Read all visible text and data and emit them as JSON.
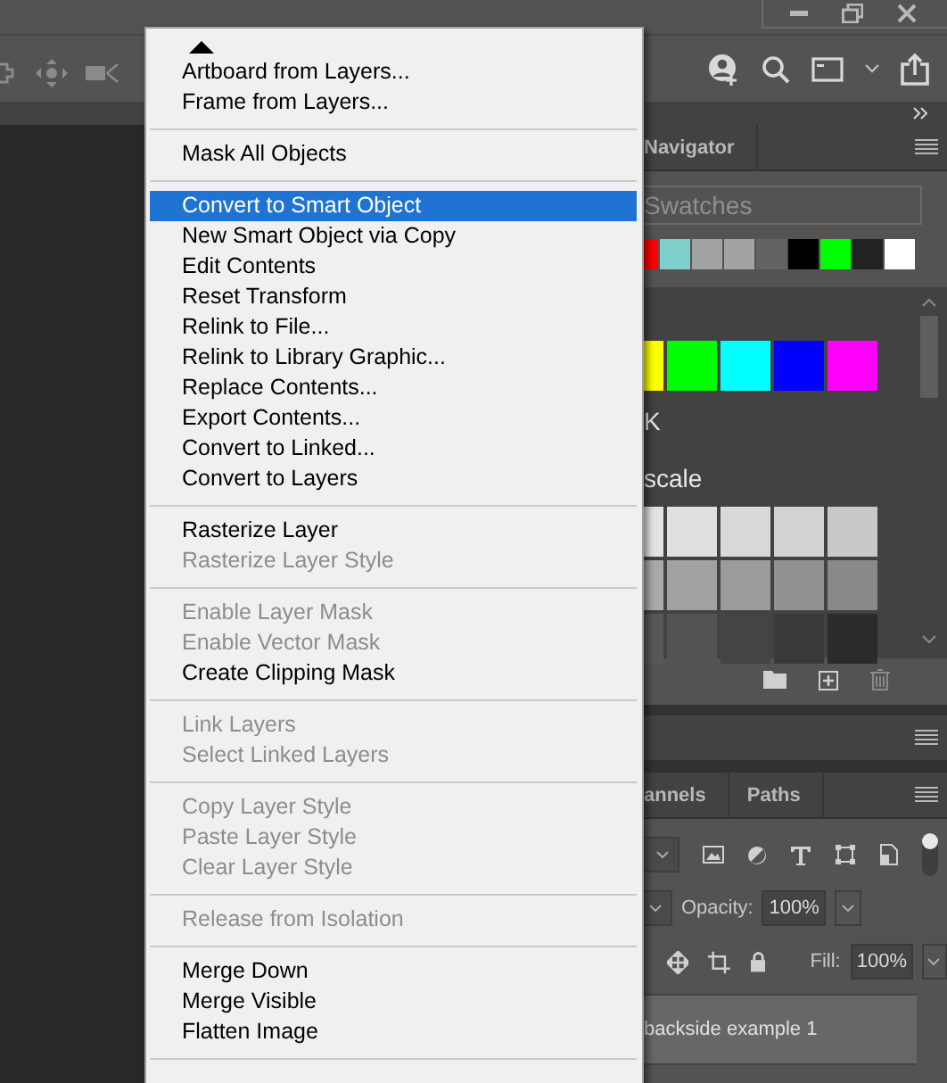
{
  "menu": {
    "sections": [
      {
        "items": [
          {
            "label": "Artboard from Layers...",
            "disabled": false,
            "selected": false
          },
          {
            "label": "Frame from Layers...",
            "disabled": false,
            "selected": false
          }
        ]
      },
      {
        "items": [
          {
            "label": "Mask All Objects",
            "disabled": false,
            "selected": false
          }
        ]
      },
      {
        "items": [
          {
            "label": "Convert to Smart Object",
            "disabled": false,
            "selected": true
          },
          {
            "label": "New Smart Object via Copy",
            "disabled": false,
            "selected": false
          },
          {
            "label": "Edit Contents",
            "disabled": false,
            "selected": false
          },
          {
            "label": "Reset Transform",
            "disabled": false,
            "selected": false
          },
          {
            "label": "Relink to File...",
            "disabled": false,
            "selected": false
          },
          {
            "label": "Relink to Library Graphic...",
            "disabled": false,
            "selected": false
          },
          {
            "label": "Replace Contents...",
            "disabled": false,
            "selected": false
          },
          {
            "label": "Export Contents...",
            "disabled": false,
            "selected": false
          },
          {
            "label": "Convert to Linked...",
            "disabled": false,
            "selected": false
          },
          {
            "label": "Convert to Layers",
            "disabled": false,
            "selected": false
          }
        ]
      },
      {
        "items": [
          {
            "label": "Rasterize Layer",
            "disabled": false,
            "selected": false
          },
          {
            "label": "Rasterize Layer Style",
            "disabled": true,
            "selected": false
          }
        ]
      },
      {
        "items": [
          {
            "label": "Enable Layer Mask",
            "disabled": true,
            "selected": false
          },
          {
            "label": "Enable Vector Mask",
            "disabled": true,
            "selected": false
          },
          {
            "label": "Create Clipping Mask",
            "disabled": false,
            "selected": false
          }
        ]
      },
      {
        "items": [
          {
            "label": "Link Layers",
            "disabled": true,
            "selected": false
          },
          {
            "label": "Select Linked Layers",
            "disabled": true,
            "selected": false
          }
        ]
      },
      {
        "items": [
          {
            "label": "Copy Layer Style",
            "disabled": true,
            "selected": false
          },
          {
            "label": "Paste Layer Style",
            "disabled": true,
            "selected": false
          },
          {
            "label": "Clear Layer Style",
            "disabled": true,
            "selected": false
          }
        ]
      },
      {
        "items": [
          {
            "label": "Release from Isolation",
            "disabled": true,
            "selected": false
          }
        ]
      },
      {
        "items": [
          {
            "label": "Merge Down",
            "disabled": false,
            "selected": false
          },
          {
            "label": "Merge Visible",
            "disabled": false,
            "selected": false
          },
          {
            "label": "Flatten Image",
            "disabled": false,
            "selected": false
          }
        ]
      }
    ]
  },
  "navigator_panel": {
    "tab": "Navigator"
  },
  "swatches_panel": {
    "search": {
      "placeholder": "Swatches"
    },
    "recent": [
      {
        "color": "#ff0000"
      },
      {
        "color": "#7fd0cc"
      },
      {
        "color": "#a3a3a3"
      },
      {
        "color": "#a3a3a3"
      },
      {
        "color": "#636363"
      },
      {
        "color": "#000000"
      },
      {
        "color": "#00ff00"
      },
      {
        "color": "#222222"
      },
      {
        "color": "#ffffff"
      }
    ],
    "groups": [
      {
        "swatches": [
          {
            "color": "#ffff00"
          },
          {
            "color": "#00ff00"
          },
          {
            "color": "#00ffff"
          },
          {
            "color": "#0000ff"
          },
          {
            "color": "#ff00ff"
          }
        ]
      },
      {
        "label": "K"
      },
      {
        "label": "scale",
        "swatches": [
          {
            "color": "#e3e3e3"
          },
          {
            "color": "#e0e0e0"
          },
          {
            "color": "#d9d9d9"
          },
          {
            "color": "#d2d2d2"
          },
          {
            "color": "#c9c9c9"
          },
          {
            "color": "#a9a9a9"
          },
          {
            "color": "#a2a2a2"
          },
          {
            "color": "#9b9b9b"
          },
          {
            "color": "#929292"
          },
          {
            "color": "#898989"
          },
          {
            "color": "#585858"
          },
          {
            "color": "#545454"
          },
          {
            "color": "#444444"
          },
          {
            "color": "#393939"
          },
          {
            "color": "#2b2b2b"
          }
        ]
      }
    ]
  },
  "layers_panel": {
    "tabs": [
      {
        "label": "annels",
        "selected": false
      },
      {
        "label": "Paths",
        "selected": false
      }
    ],
    "opacity": {
      "label": "Opacity:",
      "value": "100%"
    },
    "fill": {
      "label": "Fill:",
      "value": "100%"
    },
    "layers": [
      {
        "name": "backside example 1",
        "selected": true
      }
    ]
  }
}
